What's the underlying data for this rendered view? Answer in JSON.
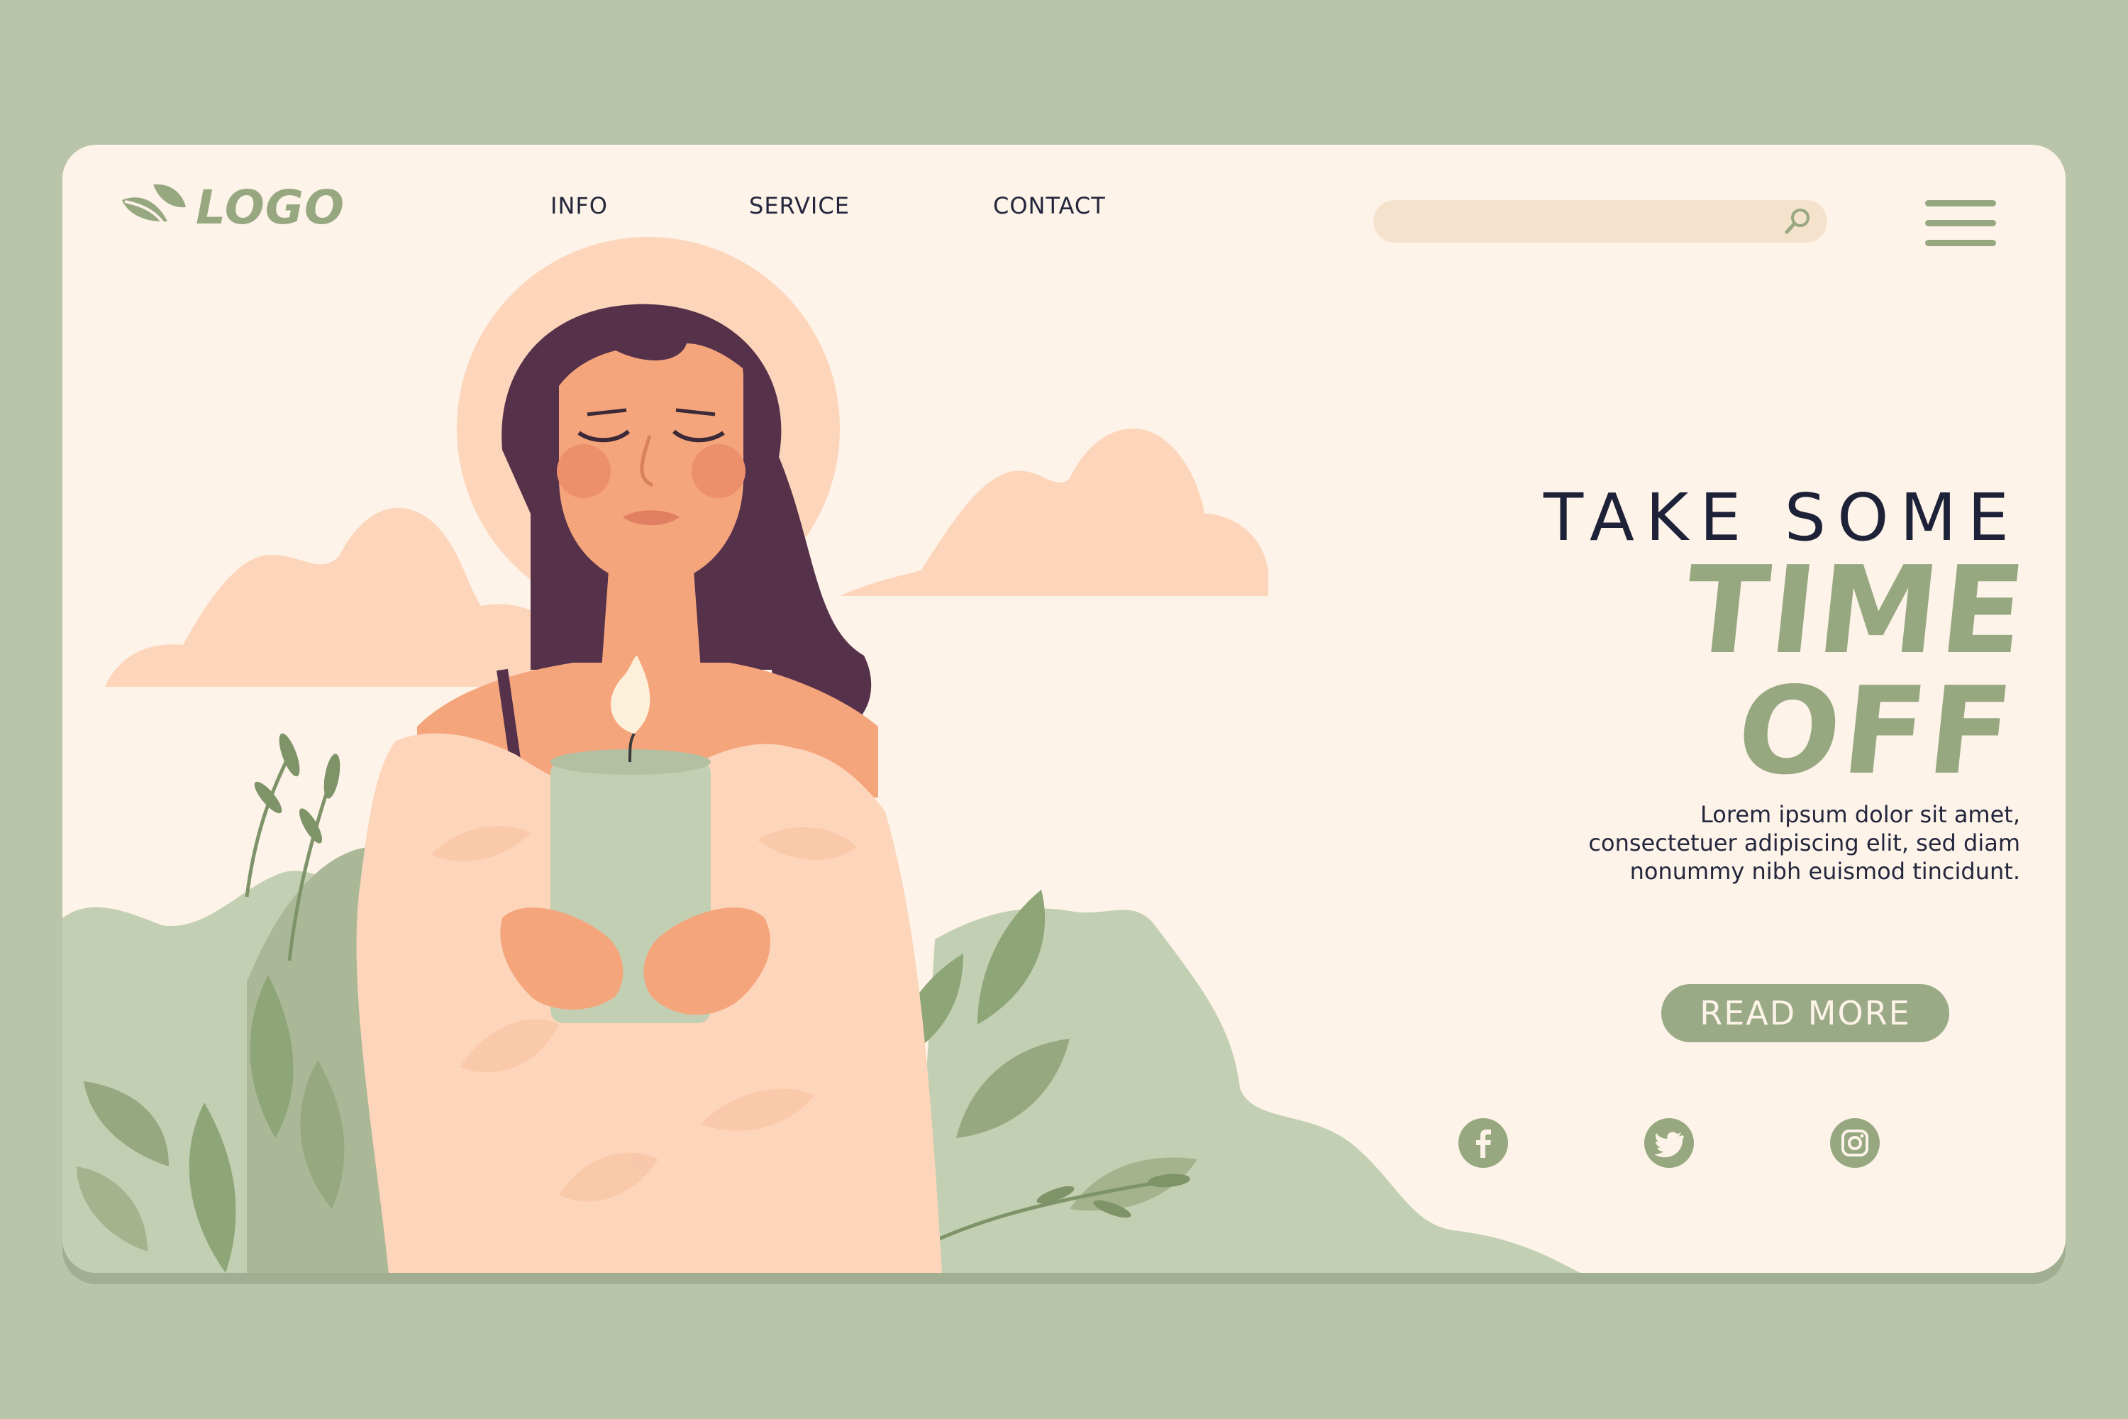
{
  "logo": {
    "text": "LOGO"
  },
  "nav": {
    "items": [
      {
        "label": "INFO"
      },
      {
        "label": "SERVICE"
      },
      {
        "label": "CONTACT"
      }
    ]
  },
  "search": {
    "placeholder": ""
  },
  "hero": {
    "line1": "TAKE SOME",
    "line2": "TIME OFF",
    "body_lines": [
      "Lorem ipsum dolor sit amet,",
      "consectetuer adipiscing elit, sed diam",
      "nonummy nibh euismod tincidunt."
    ],
    "cta_label": "READ MORE"
  },
  "social": {
    "icons": [
      "facebook-icon",
      "twitter-icon",
      "instagram-icon"
    ]
  },
  "colors": {
    "page_bg": "#b9c4a8",
    "card_bg": "#fdf3e8",
    "sage": "#97a881",
    "dark_text": "#1e2238",
    "search_bg": "#f5e2cc",
    "skin": "#f5a57c",
    "hair": "#55314a",
    "sweater": "#fdd5bb",
    "candle": "#c3cfb2",
    "cloud": "#fdd5bb"
  }
}
